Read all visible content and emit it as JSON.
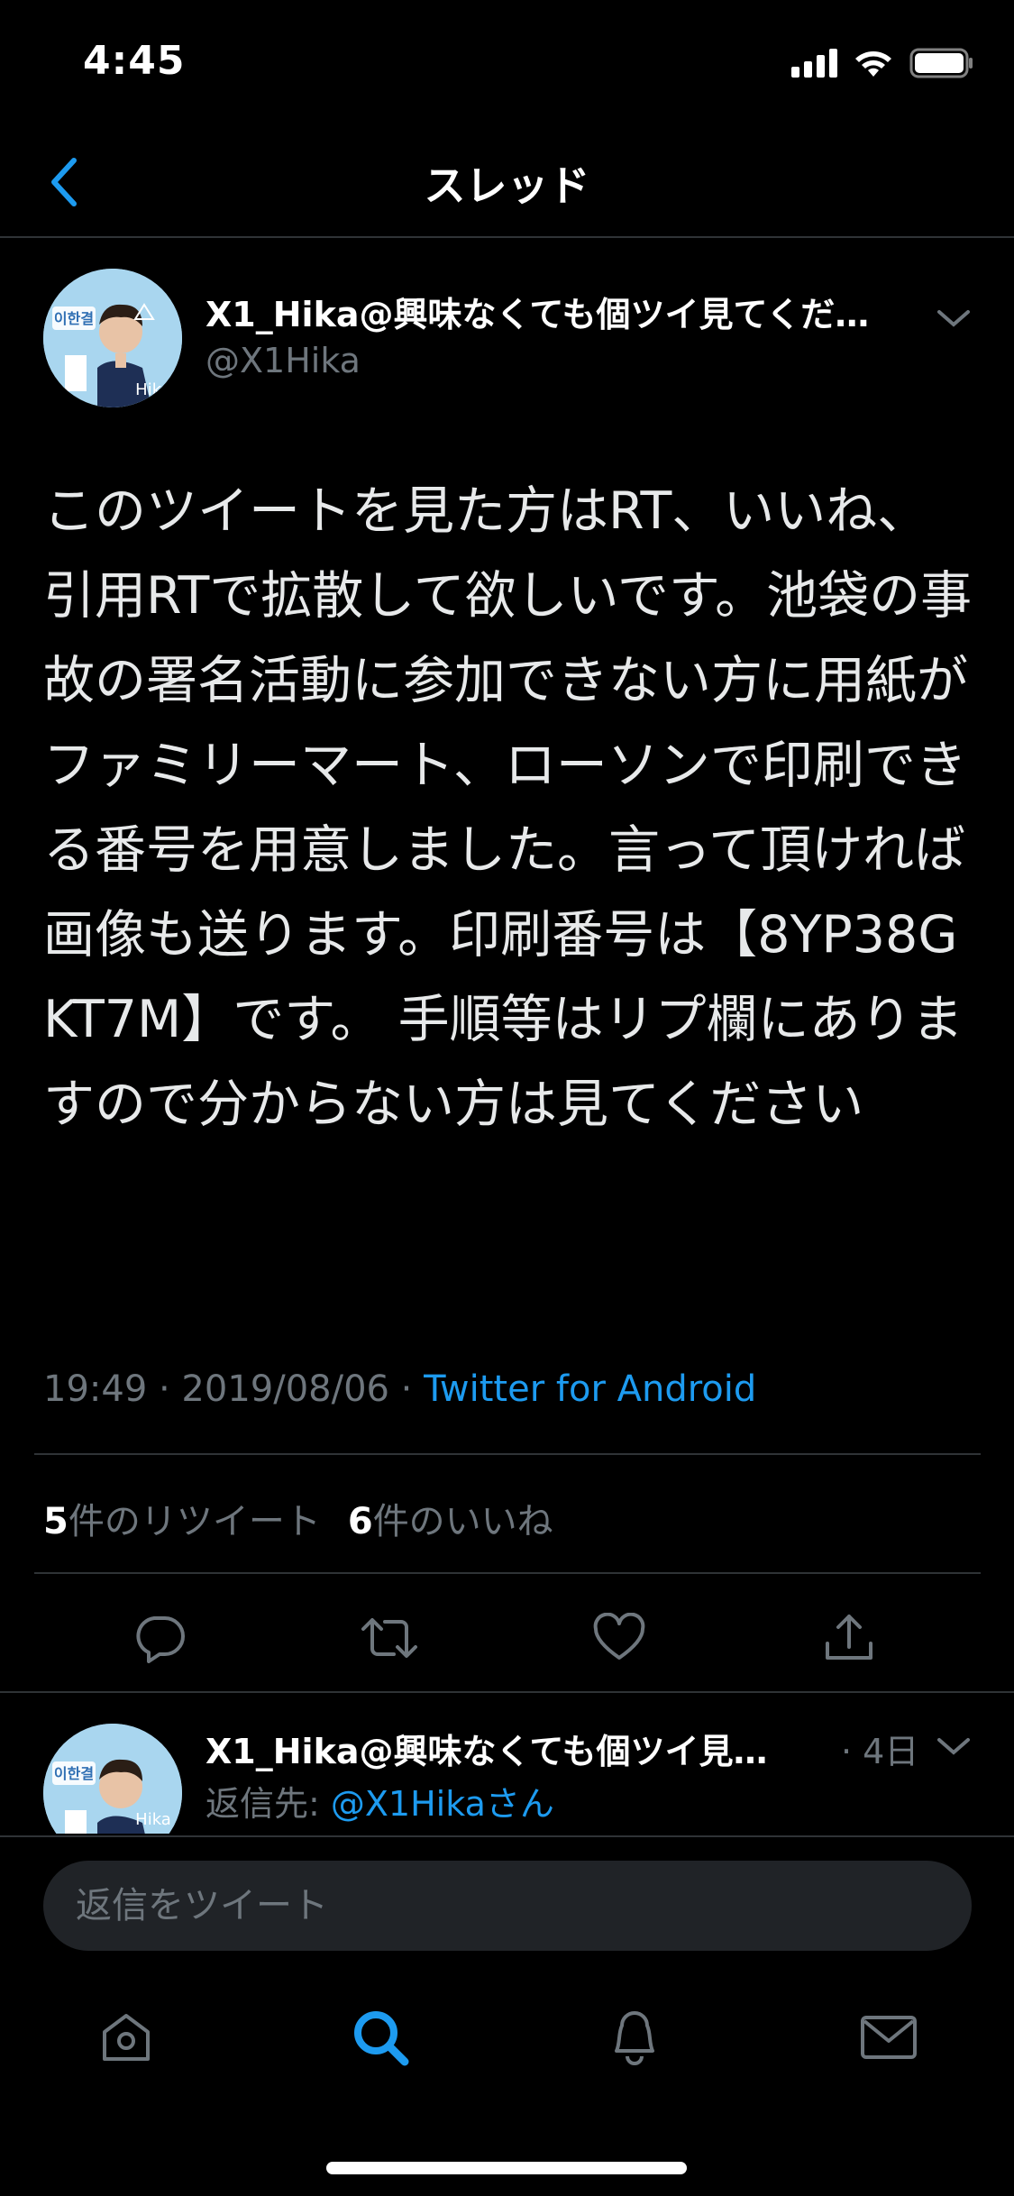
{
  "status_bar": {
    "time": "4:45"
  },
  "nav": {
    "title": "スレッド"
  },
  "tweet": {
    "display_name": "X1_Hika@興味なくても個ツイ見てくだ…",
    "handle": "@X1Hika",
    "avatar_text": "이한결",
    "avatar_caption": "Hika",
    "body": "このツイートを見た方はRT、いいね、引用RTで拡散して欲しいです。池袋の事故の署名活動に参加できない方に用紙がファミリーマート、ローソンで印刷できる番号を用意しました。言って頂ければ画像も送ります。印刷番号は【8YP38GKT7M】です。 手順等はリプ欄にありますので分からない方は見てください",
    "timestamp": "19:49 · 2019/08/06 · ",
    "source": "Twitter for Android",
    "retweet_count": "5",
    "retweet_label": "件のリツイート",
    "like_count": "6",
    "like_label": "件のいいね"
  },
  "reply": {
    "display_name": "X1_Hika@興味なくても個ツイ見…",
    "time": "· 4日",
    "reply_to_prefix": "返信先: ",
    "reply_to_handle": "@X1Hikaさん"
  },
  "compose": {
    "placeholder": "返信をツイート"
  },
  "colors": {
    "accent": "#1d9bf0",
    "background": "#000000",
    "muted": "#6e767d",
    "divider": "#2f3336"
  },
  "icons": {
    "back": "chevron-left-icon",
    "reply": "reply-icon",
    "retweet": "retweet-icon",
    "like": "heart-icon",
    "share": "share-icon",
    "home": "home-icon",
    "search": "search-icon",
    "notifications": "bell-icon",
    "messages": "mail-icon"
  }
}
